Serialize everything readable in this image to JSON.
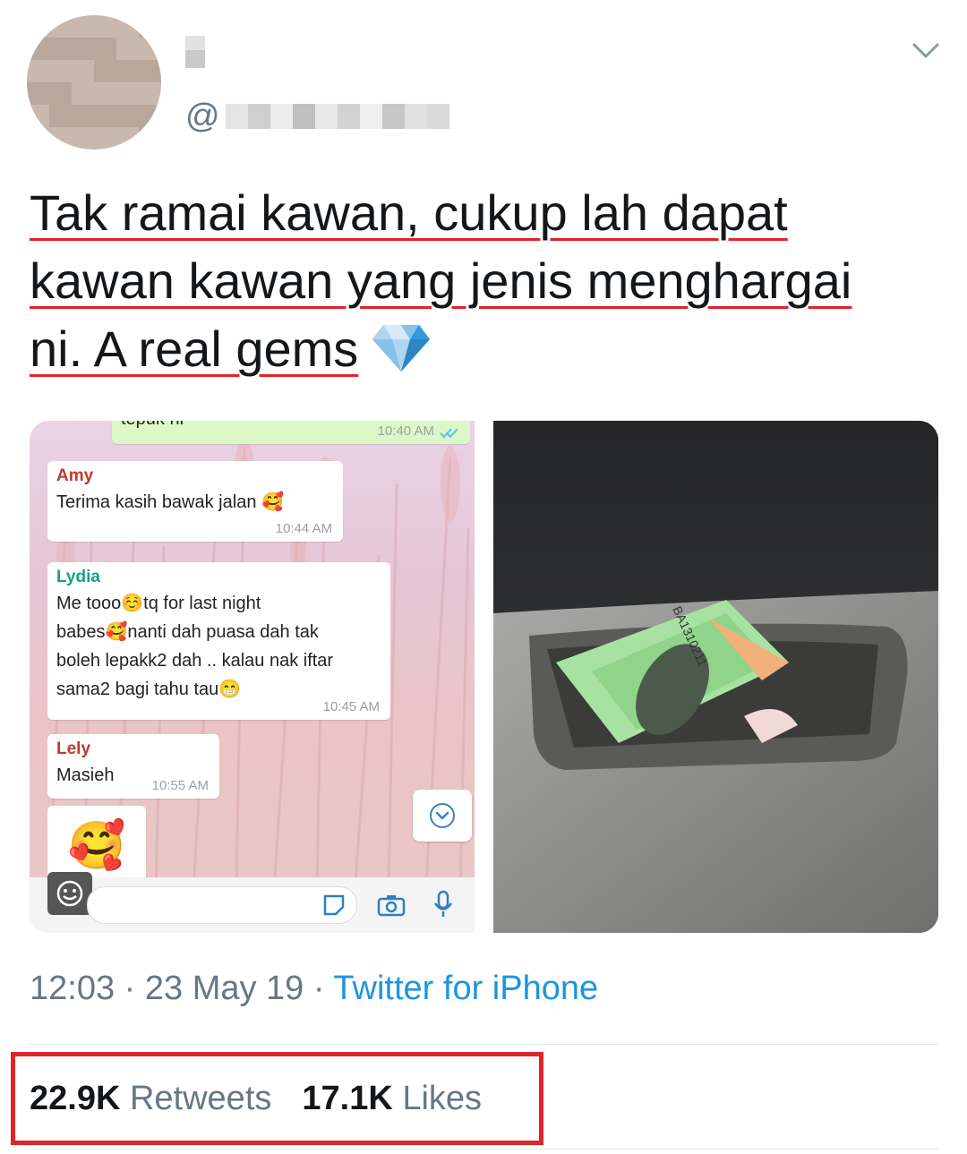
{
  "tweet": {
    "handle_prefix": "@",
    "lines": [
      "Tak ramai kawan, cukup lah dapat",
      "kawan kawan yang jenis menghargai",
      "ni. A real gems"
    ],
    "emoji_icon": "gem-stone-icon"
  },
  "chat_screenshot": {
    "top_partial_text": "tepuk ni",
    "top_time": "10:40 AM",
    "messages": [
      {
        "sender": "Amy",
        "sender_color": "#c0392b",
        "lines": [
          "Terima kasih bawak jalan 🥰"
        ],
        "time": "10:44 AM"
      },
      {
        "sender": "Lydia",
        "sender_color": "#16a085",
        "lines": [
          "Me tooo☺️tq for last night",
          "babes🥰nanti dah puasa dah tak",
          "boleh lepakk2 dah .. kalau nak iftar",
          "sama2 bagi tahu tau😁"
        ],
        "time": "10:45 AM"
      },
      {
        "sender": "Lely",
        "sender_color": "#c0392b",
        "lines": [
          "Masieh"
        ],
        "time": "10:55 AM"
      }
    ],
    "sticker": "🥰"
  },
  "meta": {
    "time": "12:03",
    "sep1": " · ",
    "date": "23 May 19",
    "sep2": " · ",
    "source": "Twitter for iPhone"
  },
  "stats": {
    "retweets_count": "22.9K",
    "retweets_label": "Retweets",
    "likes_count": "17.1K",
    "likes_label": "Likes"
  },
  "colors": {
    "link_blue": "#1b95e0",
    "muted_gray": "#657786",
    "highlight_red": "#e0242c"
  }
}
